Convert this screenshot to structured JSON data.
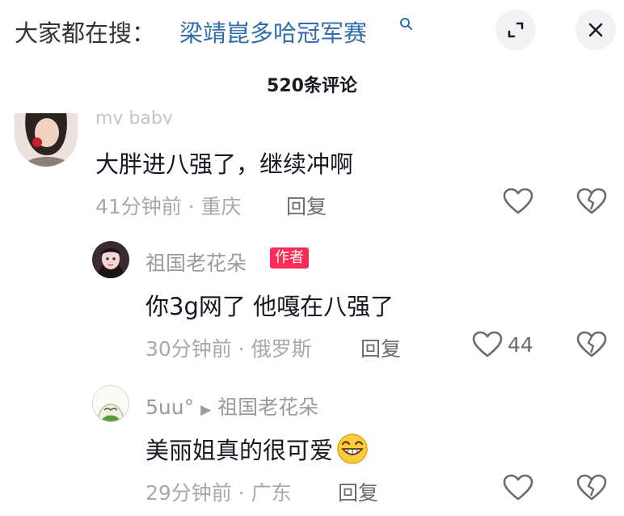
{
  "header": {
    "search_prefix": "大家都在搜：",
    "search_term": "梁靖崑多哈冠军赛",
    "comment_count": "520条评论"
  },
  "comments": [
    {
      "name": "my baby",
      "content": "大胖进八强了，继续冲啊",
      "time": "41分钟前",
      "location": "重庆",
      "reply_label": "回复"
    },
    {
      "name": "祖国老花朵",
      "badge": "作者",
      "content": "你3g网了 他嘎在八强了",
      "time": "30分钟前",
      "location": "俄罗斯",
      "reply_label": "回复",
      "likes": "44"
    },
    {
      "name": "5uu°",
      "reply_to": "祖国老花朵",
      "content": "美丽姐真的很可爱",
      "time": "29分钟前",
      "location": "广东",
      "reply_label": "回复"
    }
  ],
  "colors": {
    "accent": "#fe2c55",
    "link": "#2f6ea8"
  }
}
